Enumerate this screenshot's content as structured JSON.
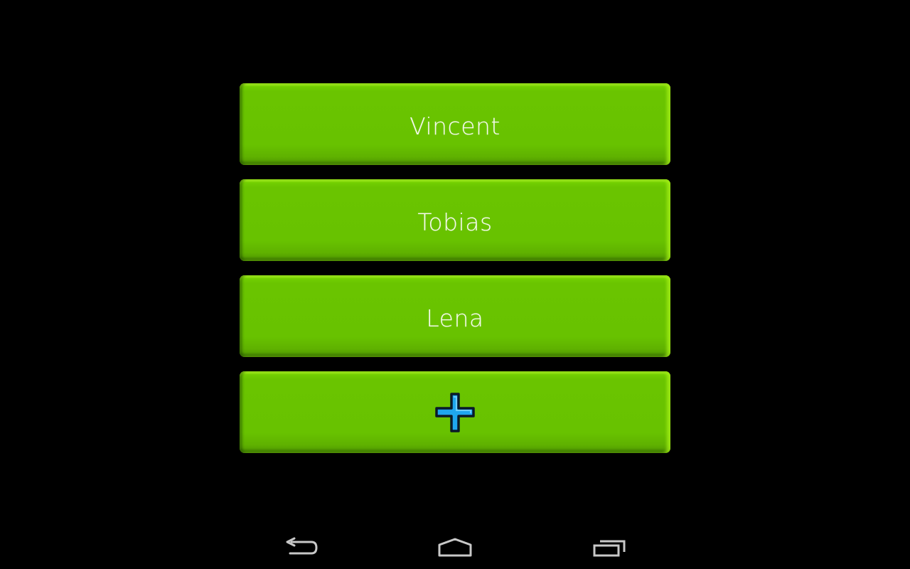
{
  "profiles": [
    {
      "name": "Vincent"
    },
    {
      "name": "Tobias"
    },
    {
      "name": "Lena"
    }
  ],
  "add_button": {
    "icon": "plus-icon",
    "icon_fill": "#1fa6ee",
    "icon_outline": "#0a1a2a"
  },
  "colors": {
    "background": "#000000",
    "button_green": "#68c200",
    "label_text": "#f4f9ec",
    "nav_icon": "#c8c8c8"
  },
  "nav_bar": {
    "items": [
      {
        "icon": "back-icon"
      },
      {
        "icon": "home-icon"
      },
      {
        "icon": "recent-apps-icon"
      }
    ]
  }
}
